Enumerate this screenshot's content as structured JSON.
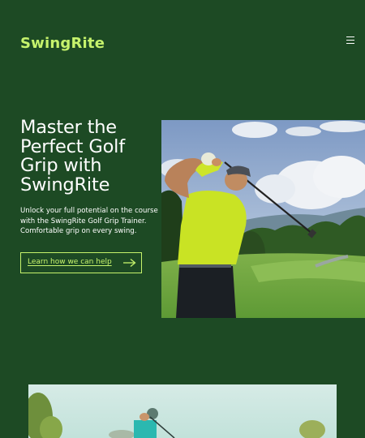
{
  "brand": {
    "name": "SwingRite",
    "accent_color": "#c6f36c",
    "background_color": "#1d4a24"
  },
  "header": {
    "menu_icon": "hamburger-menu-icon"
  },
  "hero": {
    "title": "Master the Perfect Golf Grip with SwingRite",
    "description": "Unlock your full potential on the course with the SwingRite Golf Grip Trainer. Comfortable grip on every swing.",
    "cta_label": "Learn how we can help",
    "cta_icon": "arrow-right-icon"
  }
}
